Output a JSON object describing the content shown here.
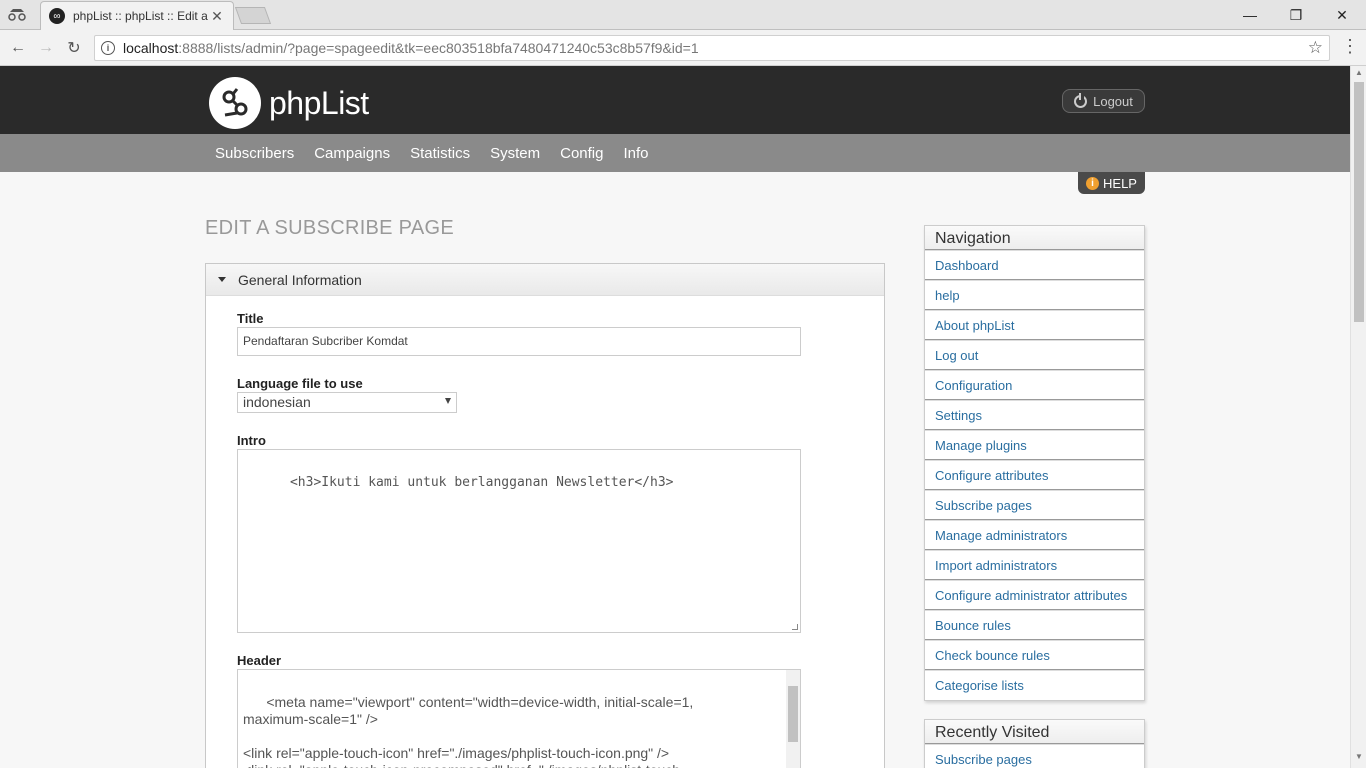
{
  "browser": {
    "tab_title": "phpList :: phpList :: Edit a",
    "url_host": "localhost",
    "url_rest": ":8888/lists/admin/?page=spageedit&tk=eec803518bfa7480471240c53c8b57f9&id=1"
  },
  "header": {
    "logo_text": "phpList",
    "logout_label": "Logout",
    "help_label": "HELP"
  },
  "menu": [
    "Subscribers",
    "Campaigns",
    "Statistics",
    "System",
    "Config",
    "Info"
  ],
  "page": {
    "title": "EDIT A SUBSCRIBE PAGE"
  },
  "panel": {
    "section_title": "General Information",
    "title_label": "Title",
    "title_value": "Pendaftaran Subcriber Komdat",
    "language_label": "Language file to use",
    "language_value": "indonesian",
    "intro_label": "Intro",
    "intro_value": "<h3>Ikuti kami untuk berlangganan Newsletter</h3>",
    "header_label": "Header",
    "header_value": "<meta name=\"viewport\" content=\"width=device-width, initial-scale=1,\nmaximum-scale=1\" />\n\n<link rel=\"apple-touch-icon\" href=\"./images/phplist-touch-icon.png\" />\n<link rel=\"apple-touch-icon-precomposed\" href=\"./images/phplist-touch-\nicon.png\" />"
  },
  "navigation": {
    "title": "Navigation",
    "items": [
      "Dashboard",
      "help",
      "About phpList",
      "Log out",
      "Configuration",
      "Settings",
      "Manage plugins",
      "Configure attributes",
      "Subscribe pages",
      "Manage administrators",
      "Import administrators",
      "Configure administrator attributes",
      "Bounce rules",
      "Check bounce rules",
      "Categorise lists"
    ]
  },
  "recent": {
    "title": "Recently Visited",
    "items": [
      "Subscribe pages"
    ]
  }
}
